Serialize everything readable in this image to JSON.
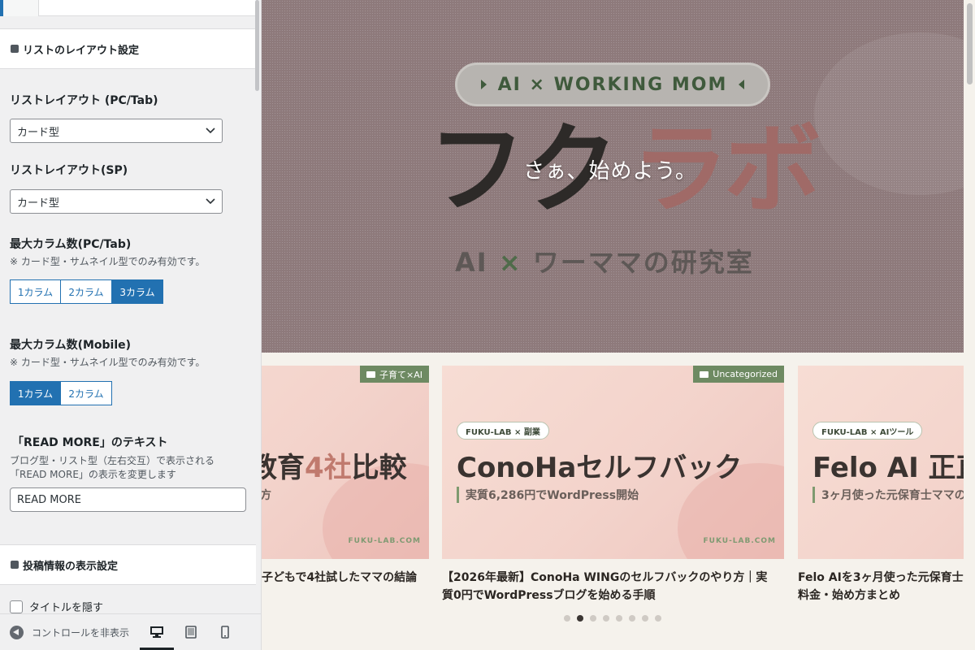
{
  "sidebar": {
    "section_list_layout": "リストのレイアウト設定",
    "list_layout_pc_label": "リストレイアウト (PC/Tab)",
    "list_layout_pc_value": "カード型",
    "list_layout_sp_label": "リストレイアウト(SP)",
    "list_layout_sp_value": "カード型",
    "max_columns_pc_label": "最大カラム数(PC/Tab)",
    "max_columns_pc_note": "※ カード型・サムネイル型でのみ有効です。",
    "max_columns_pc_options": [
      "1カラム",
      "2カラム",
      "3カラム"
    ],
    "max_columns_pc_selected": "3カラム",
    "max_columns_mobile_label": "最大カラム数(Mobile)",
    "max_columns_mobile_note": "※ カード型・サムネイル型でのみ有効です。",
    "max_columns_mobile_options": [
      "1カラム",
      "2カラム"
    ],
    "max_columns_mobile_selected": "1カラム",
    "read_more_label": "「READ MORE」のテキスト",
    "read_more_desc_1": "ブログ型・リスト型（左右交互）で表示される",
    "read_more_desc_2": "「READ MORE」の表示を変更します",
    "read_more_value": "READ MORE",
    "section_post_info": "投稿情報の表示設定",
    "hide_title_label": "タイトルを隠す",
    "hide_title_checked": false
  },
  "footer": {
    "hide_controls": "コントロールを非表示",
    "devices": [
      "desktop-icon",
      "tablet-icon",
      "mobile-icon"
    ],
    "active_device": "desktop"
  },
  "hero": {
    "pill": "AI × WORKING MOM",
    "logo_left": "フク",
    "logo_right": "ラボ",
    "tagline": "さぁ、始めよう。",
    "subtitle_a": "AI",
    "subtitle_x": "×",
    "subtitle_b": "ワーママの研究室"
  },
  "cards": [
    {
      "category": "子育て×AI",
      "headline_a": "教育",
      "headline_acc": "4社",
      "headline_b": "比較",
      "subline": "方",
      "brand": "FUKU-LAB.COM",
      "title": "子どもで4社試したママの結論"
    },
    {
      "category": "Uncategorized",
      "chip": "FUKU-LAB × 副業",
      "headline_a": "ConoHaセルフバック",
      "subline": "実質6,286円でWordPress開始",
      "brand": "FUKU-LAB.COM",
      "title_1": "【2026年最新】ConoHa WINGのセルフバックのやり方｜実",
      "title_2": "質0円でWordPressブログを始める手順"
    },
    {
      "chip": "FUKU-LAB × AIツール",
      "headline_a": "Felo AI 正直",
      "subline": "3ヶ月使った元保育士ママの",
      "title_1": "Felo AIを3ヶ月使った元保育士",
      "title_2": "料金・始め方まとめ"
    }
  ],
  "slider": {
    "count": 8,
    "active_index": 1
  },
  "colors": {
    "accent": "#2271b1",
    "category_badge": "#6e8a62",
    "hero_overlay": "#8e7a7b",
    "logo_pink": "#a06a67"
  }
}
